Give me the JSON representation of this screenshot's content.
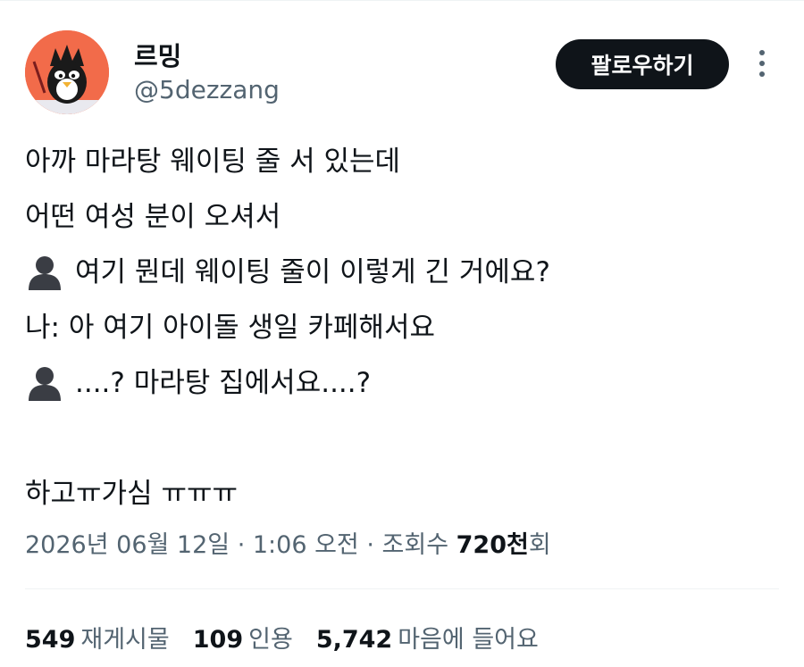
{
  "user": {
    "display_name": "르밍",
    "handle": "@5dezzang",
    "follow_label": "팔로우하기"
  },
  "tweet": {
    "lines": [
      {
        "icon": null,
        "text": "아까 마라탕 웨이팅 줄 서 있는데"
      },
      {
        "icon": null,
        "text": "어떤 여성 분이 오셔서"
      },
      {
        "icon": "person-silhouette-icon",
        "text": "여기 뭔데 웨이팅 줄이 이렇게 긴 거에요?"
      },
      {
        "icon": null,
        "text": "나: 아 여기 아이돌 생일 카페해서요"
      },
      {
        "icon": "person-silhouette-icon",
        "text": "....? 마라탕 집에서요....?"
      },
      {
        "icon": null,
        "text": ""
      },
      {
        "icon": null,
        "text": "하고ㅠ가심 ㅠㅠㅠ"
      }
    ]
  },
  "meta": {
    "date": "2026년 06월 12일",
    "sep1": " · ",
    "time": "1:06 오전",
    "sep2": " · ",
    "views_label": "조회수 ",
    "views_value": "720천",
    "views_suffix": "회"
  },
  "stats": {
    "retweets": {
      "value": "549",
      "label": "재게시물"
    },
    "quotes": {
      "value": "109",
      "label": "인용"
    },
    "likes": {
      "value": "5,742",
      "label": "마음에 들어요"
    }
  },
  "colors": {
    "text": "#0f1419",
    "secondary": "#536471",
    "button_bg": "#0f1419",
    "avatar_bg": "#f26b4a"
  }
}
